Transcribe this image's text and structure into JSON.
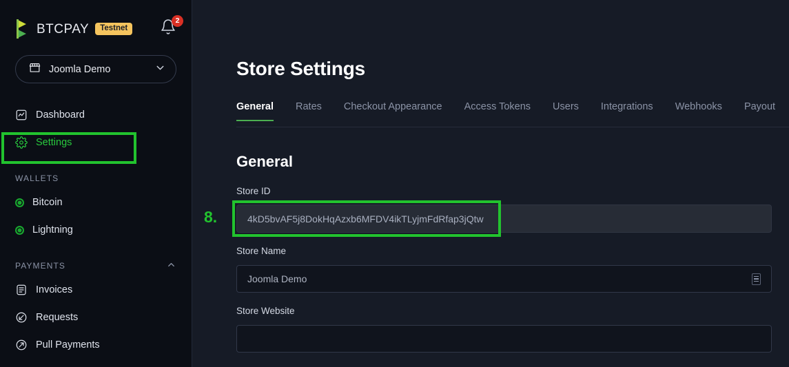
{
  "brand": {
    "name": "BTCPAY",
    "badge": "Testnet",
    "logo_icon": "btcpay-logo-icon",
    "accent_green": "#22c32e",
    "badge_bg": "#f5c45e"
  },
  "notifications": {
    "icon": "bell-icon",
    "count": "2",
    "badge_color": "#d93025"
  },
  "store_selector": {
    "icon": "store-icon",
    "label": "Joomla Demo",
    "chevron_icon": "chevron-down-icon"
  },
  "sidebar": {
    "items": [
      {
        "label": "Dashboard",
        "icon": "dashboard-icon",
        "active": false
      },
      {
        "label": "Settings",
        "icon": "gear-icon",
        "active": true
      }
    ],
    "wallets_section": {
      "label": "WALLETS"
    },
    "wallets": [
      {
        "label": "Bitcoin",
        "icon": "status-dot-icon"
      },
      {
        "label": "Lightning",
        "icon": "status-dot-icon"
      }
    ],
    "payments_section": {
      "label": "PAYMENTS",
      "chevron_icon": "chevron-up-icon"
    },
    "payments": [
      {
        "label": "Invoices",
        "icon": "invoice-icon"
      },
      {
        "label": "Requests",
        "icon": "payment-request-icon"
      },
      {
        "label": "Pull Payments",
        "icon": "pull-payment-icon"
      }
    ]
  },
  "main": {
    "page_title": "Store Settings",
    "tabs": [
      {
        "label": "General",
        "active": true
      },
      {
        "label": "Rates",
        "active": false
      },
      {
        "label": "Checkout Appearance",
        "active": false
      },
      {
        "label": "Access Tokens",
        "active": false
      },
      {
        "label": "Users",
        "active": false
      },
      {
        "label": "Integrations",
        "active": false
      },
      {
        "label": "Webhooks",
        "active": false
      },
      {
        "label": "Payout",
        "active": false
      }
    ],
    "section_title": "General",
    "fields": {
      "store_id": {
        "label": "Store ID",
        "value": "4kD5bvAF5j8DokHqAzxb6MFDV4ikTLyjmFdRfap3jQtw",
        "placeholder": ""
      },
      "store_name": {
        "label": "Store Name",
        "value": "Joomla Demo",
        "placeholder": "",
        "grip_icon": "resize-grip-icon"
      },
      "store_website": {
        "label": "Store Website",
        "value": "",
        "placeholder": ""
      }
    }
  },
  "annotations": {
    "step_number": "8.",
    "highlight_color": "#22c32e"
  }
}
